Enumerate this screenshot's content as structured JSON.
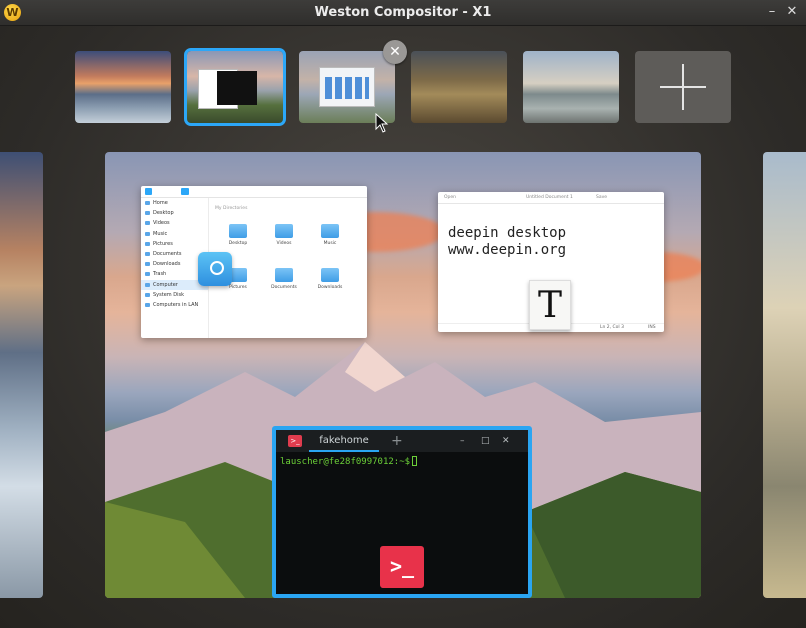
{
  "window": {
    "title": "Weston Compositor - X1",
    "logo_glyph": "W",
    "minimize_glyph": "–",
    "close_glyph": "✕"
  },
  "workspaces": {
    "thumbnails": [
      {
        "name": "workspace-1",
        "wallpaper": "sunset-shore"
      },
      {
        "name": "workspace-2",
        "wallpaper": "mountain-valley",
        "active": true
      },
      {
        "name": "workspace-3",
        "wallpaper": "desktop-windows"
      },
      {
        "name": "workspace-4",
        "wallpaper": "autumn-forest"
      },
      {
        "name": "workspace-5",
        "wallpaper": "mountain-lake"
      }
    ],
    "add_workspace_icon": "plus-icon",
    "close_badge_glyph": "✕"
  },
  "file_manager": {
    "sidebar": [
      "Home",
      "Desktop",
      "Videos",
      "Music",
      "Pictures",
      "Documents",
      "Downloads",
      "Trash",
      "Computer",
      "System Disk",
      "Computers in LAN"
    ],
    "selected": "Computer",
    "section_label": "My Directories",
    "folders": [
      "Desktop",
      "Videos",
      "Music",
      "Pictures",
      "Documents",
      "Downloads"
    ]
  },
  "text_editor": {
    "open_label": "Open",
    "doc_title": "Untitled Document 1",
    "save_label": "Save",
    "content": "deepin desktop\nwww.deepin.org",
    "status_position": "Ln 2, Col 3",
    "status_mode": "INS",
    "app_icon_glyph": "T"
  },
  "terminal": {
    "logo_glyph": ">_",
    "tab_title": "fakehome",
    "new_tab_glyph": "+",
    "ctl_min": "–",
    "ctl_max": "□",
    "ctl_close": "✕",
    "prompt": "lauscher@fe28f0997012:~$",
    "app_icon_glyph": ">_"
  },
  "colors": {
    "accent": "#2ca7f8",
    "terminal_prompt": "#6cd038",
    "terminal_icon": "#e8324a"
  }
}
